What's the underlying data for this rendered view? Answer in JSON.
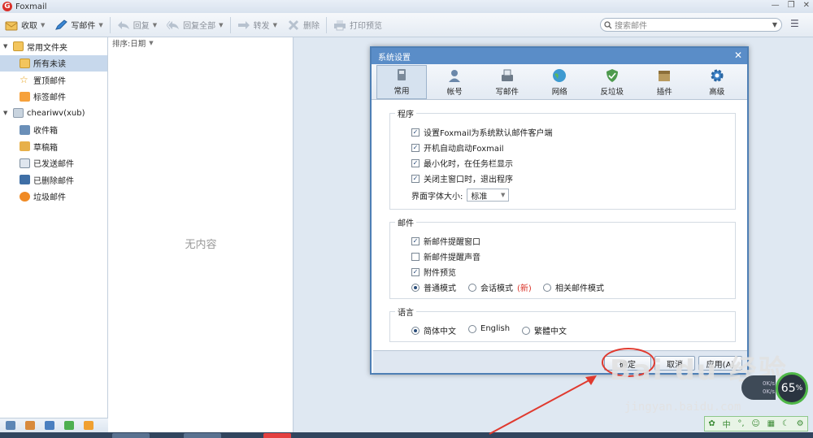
{
  "window": {
    "title": "Foxmail",
    "logo": "foxmail-logo"
  },
  "toolbar": {
    "receive": "收取",
    "compose": "写邮件",
    "reply": "回复",
    "reply_all": "回复全部",
    "forward": "转发",
    "delete": "删除",
    "print_preview": "打印预览"
  },
  "search": {
    "placeholder": "搜索邮件"
  },
  "sidebar": {
    "common_folder": "常用文件夹",
    "common_items": [
      "所有未读",
      "置顶邮件",
      "标签邮件"
    ],
    "account": "cheariwv(xub)",
    "account_items": [
      "收件箱",
      "草稿箱",
      "已发送邮件",
      "已删除邮件",
      "垃圾邮件"
    ]
  },
  "maillist": {
    "sort_label": "排序:日期",
    "empty_text": "无内容"
  },
  "dialog": {
    "title": "系统设置",
    "tabs": [
      "常用",
      "帐号",
      "写邮件",
      "网络",
      "反垃圾",
      "插件",
      "高级"
    ],
    "program": {
      "title": "程序",
      "options": [
        {
          "label": "设置Foxmail为系统默认邮件客户端",
          "checked": true
        },
        {
          "label": "开机自动启动Foxmail",
          "checked": true
        },
        {
          "label": "最小化时，在任务栏显示",
          "checked": true
        },
        {
          "label": "关闭主窗口时，退出程序",
          "checked": true
        }
      ],
      "font_size_label": "界面字体大小:",
      "font_size_value": "标准"
    },
    "mail": {
      "title": "邮件",
      "options": [
        {
          "label": "新邮件提醒窗口",
          "checked": true
        },
        {
          "label": "新邮件提醒声音",
          "checked": false
        },
        {
          "label": "附件预览",
          "checked": true
        }
      ],
      "modes": [
        "普通模式",
        "会话模式",
        "相关邮件模式"
      ],
      "new_tag": "(新)",
      "mode_selected": "普通模式"
    },
    "language": {
      "title": "语言",
      "options": [
        "简体中文",
        "English",
        "繁體中文"
      ],
      "selected": "简体中文"
    },
    "buttons": {
      "ok": "确定",
      "cancel": "取消",
      "apply": "应用(A)"
    }
  },
  "overlay": {
    "watermark": "Bai du 经验",
    "watermark_url": "jingyan.baidu.com",
    "speed_percent": "65",
    "speed_unit": "%",
    "speed_up": "0K/s",
    "speed_down": "0K/s",
    "ime_text": "中"
  },
  "colors": {
    "accent": "#5a8dc8",
    "annotation": "#e03a2f",
    "selection": "#c7d8ec"
  }
}
